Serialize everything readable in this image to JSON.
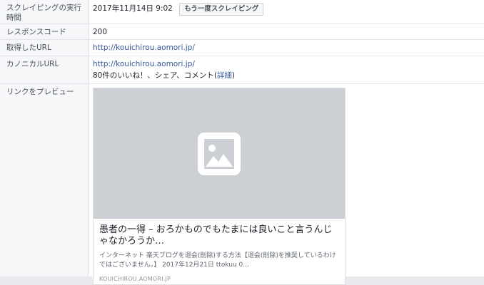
{
  "rows": {
    "scrape": {
      "label": "スクレイピングの実行時間",
      "time": "2017年11月14日 9:02",
      "button": "もう一度スクレイピング"
    },
    "response": {
      "label": "レスポンスコード",
      "value": "200"
    },
    "fetched_url": {
      "label": "取得したURL",
      "value": "http://kouichirou.aomori.jp/"
    },
    "canonical": {
      "label": "カノニカルURL",
      "value": "http://kouichirou.aomori.jp/",
      "engagement": "80件のいいね！、シェア、コメント",
      "details_link": "詳細"
    },
    "preview": {
      "label": "リンクをプレビュー",
      "image_icon": "image-placeholder-icon",
      "title": "愚者の一得 – おろかものでもたまには良いこと言うんじゃなかろうか…",
      "description": "インターネット 楽天ブログを退会(削除)する方法【退会(削除)を推奨しているわけではございません。】 2017年12月21日 ttokuu 0...",
      "domain": "KOUICHIROU.AOMORI.JP"
    }
  },
  "colors": {
    "link": "#365899",
    "placeholder_bg": "#ccd0d5",
    "label_bg": "#f6f7f9"
  }
}
